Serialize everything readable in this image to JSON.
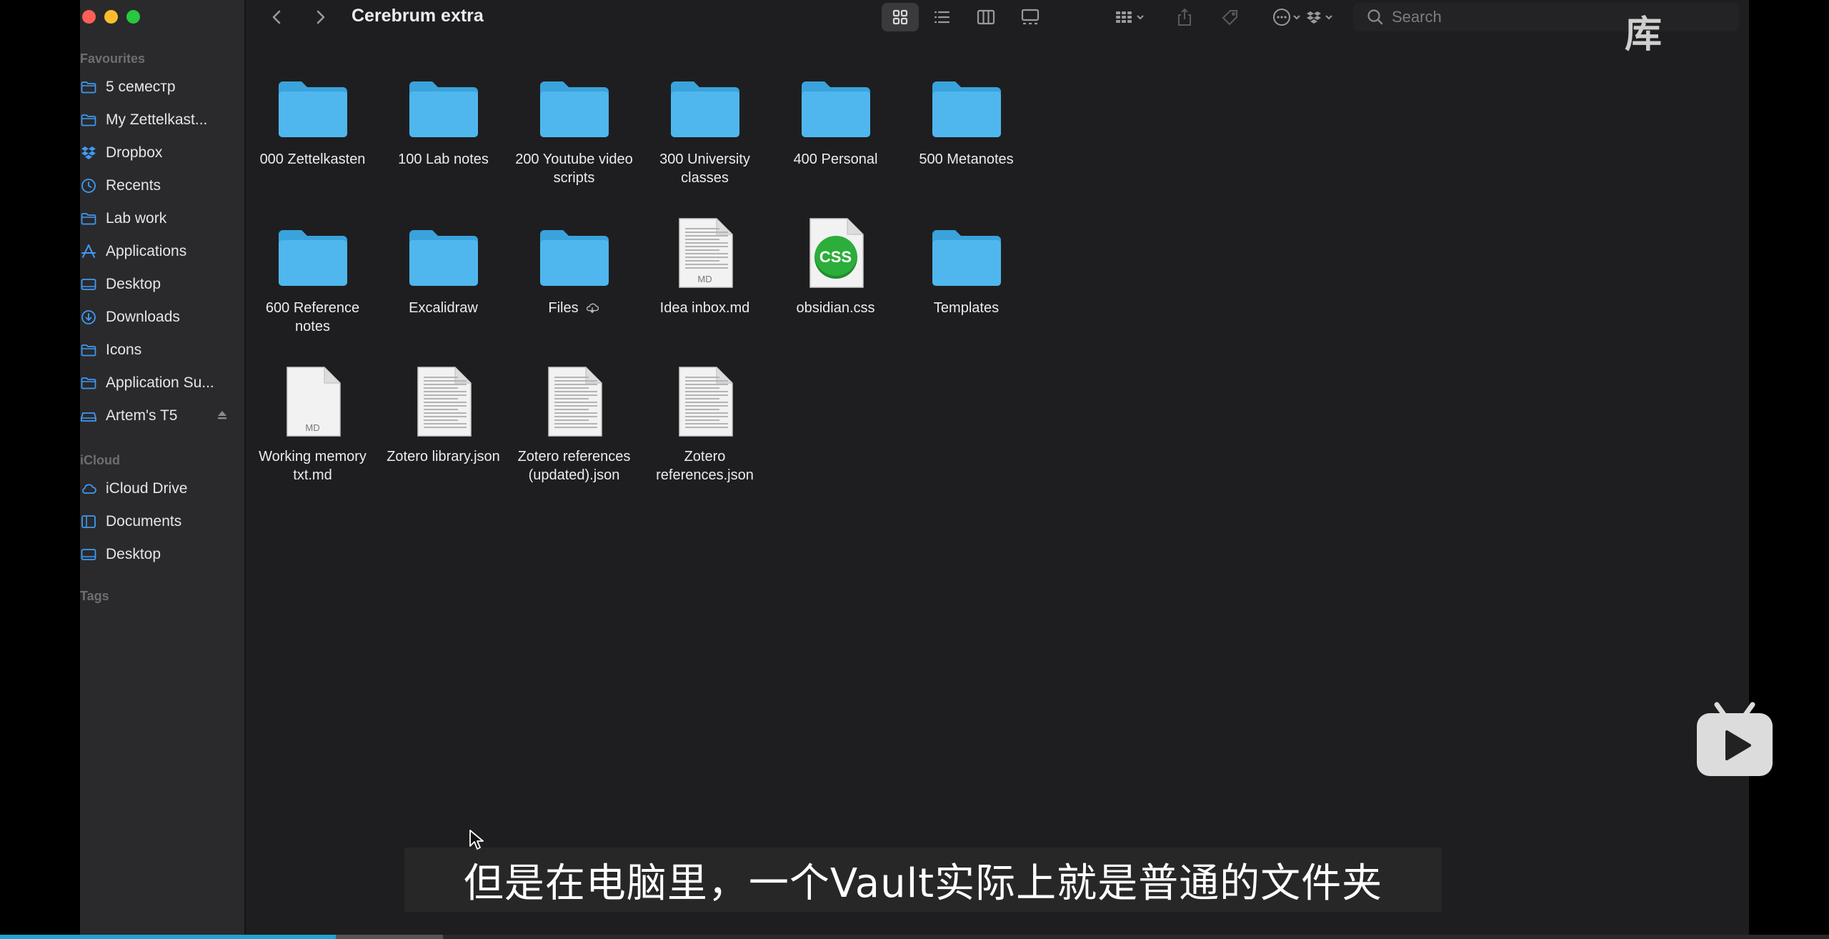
{
  "window": {
    "title": "Cerebrum extra"
  },
  "sidebar": {
    "favourites_header": "Favourites",
    "favourites": [
      {
        "label": "5 семестр",
        "icon": "folder-icon"
      },
      {
        "label": "My Zettelkast...",
        "icon": "folder-icon"
      },
      {
        "label": "Dropbox",
        "icon": "dropbox-icon"
      },
      {
        "label": "Recents",
        "icon": "clock-icon"
      },
      {
        "label": "Lab work",
        "icon": "folder-icon"
      },
      {
        "label": "Applications",
        "icon": "applications-icon"
      },
      {
        "label": "Desktop",
        "icon": "desktop-icon"
      },
      {
        "label": "Downloads",
        "icon": "download-icon"
      },
      {
        "label": "Icons",
        "icon": "folder-icon"
      },
      {
        "label": "Application Su...",
        "icon": "folder-icon"
      },
      {
        "label": "Artem's T5",
        "icon": "drive-icon"
      }
    ],
    "cloud_header": "iCloud",
    "cloud": [
      {
        "label": "iCloud Drive",
        "icon": "cloud-icon"
      },
      {
        "label": "Documents",
        "icon": "document-icon"
      },
      {
        "label": "Desktop",
        "icon": "desktop-icon"
      }
    ],
    "tags_header": "Tags"
  },
  "toolbar": {
    "search_placeholder": "Search"
  },
  "files": [
    {
      "name": "000 Zettelkasten",
      "kind": "folder"
    },
    {
      "name": "100 Lab notes",
      "kind": "folder"
    },
    {
      "name": "200 Youtube video scripts",
      "kind": "folder"
    },
    {
      "name": "300 University classes",
      "kind": "folder"
    },
    {
      "name": "400 Personal",
      "kind": "folder"
    },
    {
      "name": "500 Metanotes",
      "kind": "folder"
    },
    {
      "name": "600 Reference notes",
      "kind": "folder"
    },
    {
      "name": "Excalidraw",
      "kind": "folder"
    },
    {
      "name": "Files",
      "kind": "folder"
    },
    {
      "name": "Idea inbox.md",
      "kind": "md"
    },
    {
      "name": "obsidian.css",
      "kind": "css"
    },
    {
      "name": "Templates",
      "kind": "folder"
    },
    {
      "name": "Working memory txt.md",
      "kind": "md-blank"
    },
    {
      "name": "Zotero library.json",
      "kind": "doc"
    },
    {
      "name": "Zotero references (updated).json",
      "kind": "doc"
    },
    {
      "name": "Zotero references.json",
      "kind": "doc"
    }
  ],
  "doc_badges": {
    "md": "MD",
    "css": "CSS"
  },
  "overlay": {
    "watermark": "库",
    "subtitle": "但是在电脑里，一个Vault实际上就是普通的文件夹"
  },
  "colors": {
    "folder": "#4fb7ee",
    "folder_tab": "#3aa3dc",
    "css_badge": "#2cae3a",
    "progress": "#1fa2d6"
  }
}
